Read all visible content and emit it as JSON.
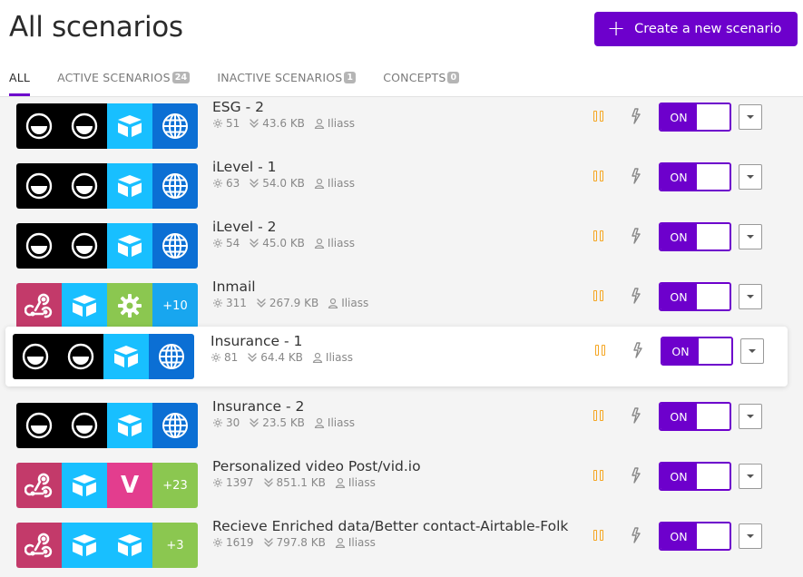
{
  "page": {
    "title": "All scenarios"
  },
  "create_button": {
    "label": "Create a new scenario"
  },
  "tabs": [
    {
      "label": "ALL",
      "count": null
    },
    {
      "label": "ACTIVE SCENARIOS",
      "count": "24"
    },
    {
      "label": "INACTIVE SCENARIOS",
      "count": "1"
    },
    {
      "label": "CONCEPTS",
      "count": "0"
    }
  ],
  "colors": {
    "accent": "#6d00cc",
    "pause": "#f5a623"
  },
  "scenarios": [
    {
      "name": "ESG - 2",
      "operations": "51",
      "size": "43.6 KB",
      "owner": "Iliass",
      "toggle": "ON",
      "apps": [
        "smile-icon",
        "smile-icon",
        "airtable-icon",
        "globe-icon"
      ]
    },
    {
      "name": "iLevel - 1",
      "operations": "63",
      "size": "54.0 KB",
      "owner": "Iliass",
      "toggle": "ON",
      "apps": [
        "smile-icon",
        "smile-icon",
        "airtable-icon",
        "globe-icon"
      ]
    },
    {
      "name": "iLevel - 2",
      "operations": "54",
      "size": "45.0 KB",
      "owner": "Iliass",
      "toggle": "ON",
      "apps": [
        "smile-icon",
        "smile-icon",
        "airtable-icon",
        "globe-icon"
      ]
    },
    {
      "name": "Inmail",
      "operations": "311",
      "size": "267.9 KB",
      "owner": "Iliass",
      "toggle": "ON",
      "apps": [
        "webhook-icon",
        "airtable-icon",
        "gear-icon"
      ],
      "more": "+10"
    },
    {
      "name": "Insurance - 1",
      "operations": "81",
      "size": "64.4 KB",
      "owner": "Iliass",
      "toggle": "ON",
      "apps": [
        "smile-icon",
        "smile-icon",
        "airtable-icon",
        "globe-icon"
      ]
    },
    {
      "name": "Insurance - 2",
      "operations": "30",
      "size": "23.5 KB",
      "owner": "Iliass",
      "toggle": "ON",
      "apps": [
        "smile-icon",
        "smile-icon",
        "airtable-icon",
        "globe-icon"
      ]
    },
    {
      "name": "Personalized video Post/vid.io",
      "operations": "1397",
      "size": "851.1 KB",
      "owner": "Iliass",
      "toggle": "ON",
      "apps": [
        "webhook-icon",
        "airtable-icon",
        "vidio-icon"
      ],
      "vidio_letter": "V",
      "more": "+23"
    },
    {
      "name": "Recieve Enriched data/Better contact-Airtable-Folk",
      "operations": "1619",
      "size": "797.8 KB",
      "owner": "Iliass",
      "toggle": "ON",
      "apps": [
        "webhook-icon",
        "airtable-icon",
        "airtable-icon"
      ],
      "more": "+3"
    }
  ]
}
